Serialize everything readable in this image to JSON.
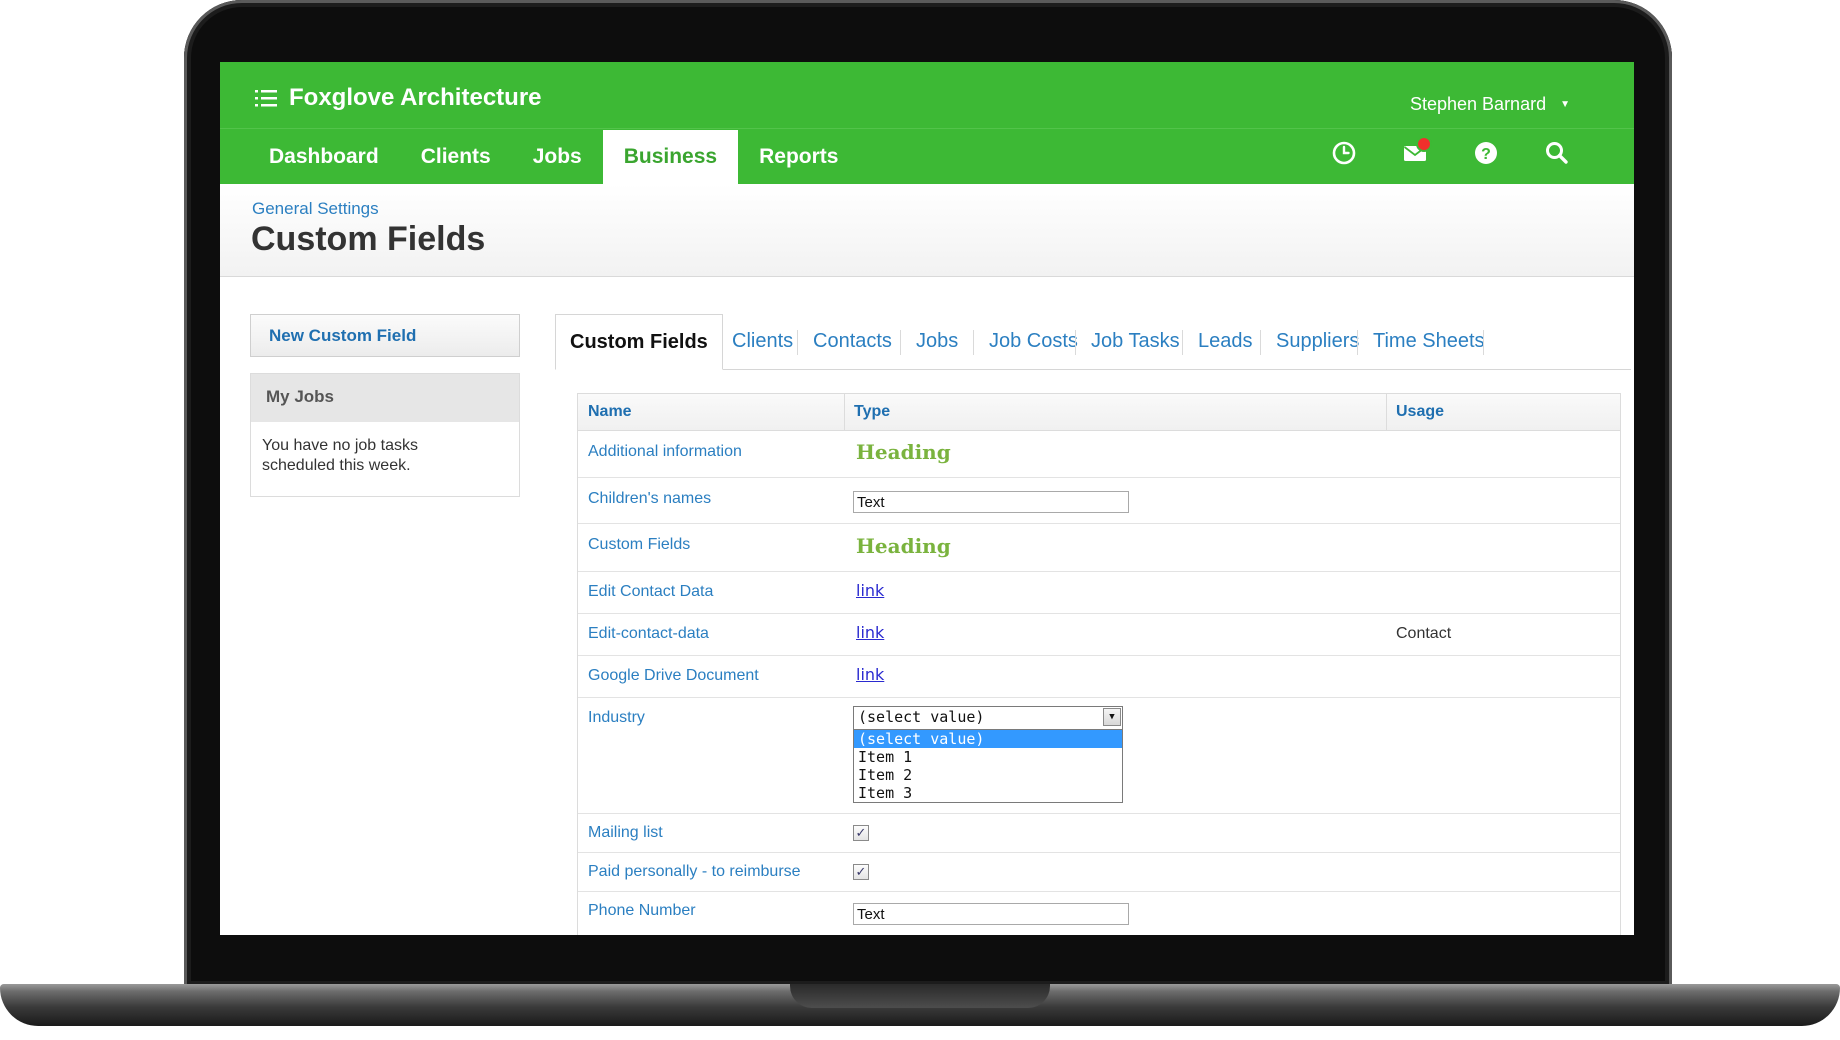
{
  "header": {
    "brand": "Foxglove Architecture",
    "user": "Stephen Barnard",
    "nav": [
      "Dashboard",
      "Clients",
      "Jobs",
      "Business",
      "Reports"
    ],
    "active_nav": "Business",
    "icons": [
      "clock-icon",
      "mail-icon",
      "help-icon",
      "search-icon"
    ],
    "accent": "#3db935"
  },
  "page": {
    "breadcrumb": "General Settings",
    "title": "Custom Fields"
  },
  "sidebar": {
    "new_button": "New Custom Field",
    "my_jobs_title": "My Jobs",
    "my_jobs_text": "You have no job tasks scheduled this week."
  },
  "tabs": [
    "Custom Fields",
    "Clients",
    "Contacts",
    "Jobs",
    "Job Costs",
    "Job Tasks",
    "Leads",
    "Suppliers",
    "Time Sheets"
  ],
  "table": {
    "headers": [
      "Name",
      "Type",
      "Usage"
    ],
    "rows": [
      {
        "name": "Additional information",
        "type": "Heading",
        "value": "Heading",
        "usage": ""
      },
      {
        "name": "Children's names",
        "type": "Text",
        "value": "Text",
        "usage": ""
      },
      {
        "name": "Custom Fields",
        "type": "Heading",
        "value": "Heading",
        "usage": ""
      },
      {
        "name": "Edit Contact Data",
        "type": "Link",
        "value": "link",
        "usage": ""
      },
      {
        "name": "Edit-contact-data",
        "type": "Link",
        "value": "link",
        "usage": "Contact"
      },
      {
        "name": "Google Drive Document",
        "type": "Link",
        "value": "link",
        "usage": ""
      },
      {
        "name": "Industry",
        "type": "Select",
        "value": "(select value)",
        "options": [
          "(select value)",
          "Item 1",
          "Item 2",
          "Item 3"
        ],
        "usage": ""
      },
      {
        "name": "Mailing list",
        "type": "Checkbox",
        "value": "✓",
        "usage": ""
      },
      {
        "name": "Paid personally - to reimburse",
        "type": "Checkbox",
        "value": "✓",
        "usage": ""
      },
      {
        "name": "Phone Number",
        "type": "Text",
        "value": "Text",
        "usage": ""
      }
    ]
  }
}
